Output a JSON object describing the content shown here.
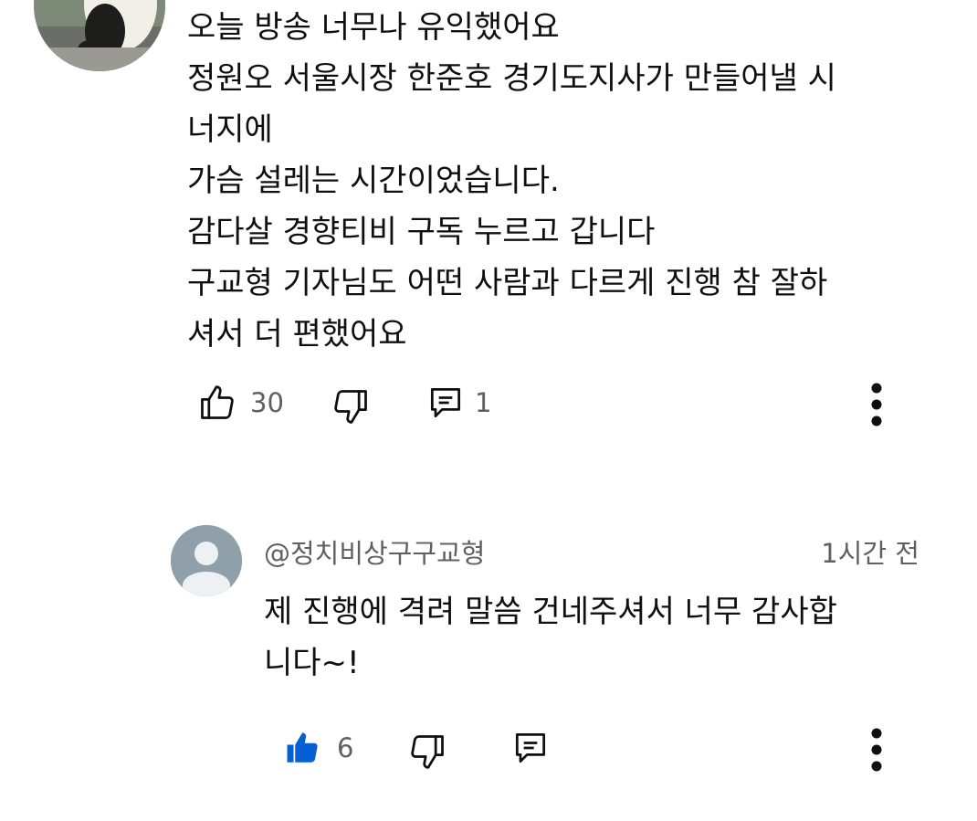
{
  "comment": {
    "lines": [
      "오늘 방송 너무나 유익했어요",
      "정원오 서울시장 한준호 경기도지사가 만들어낼 시",
      "너지에",
      "가슴 설레는 시간이었습니다.",
      "감다살 경향티비 구독 누르고 갑니다",
      "구교형 기자님도 어떤 사람과 다르게 진행 참 잘하",
      "셔서 더 편했어요"
    ],
    "like_count": "30",
    "reply_count": "1",
    "liked": false,
    "icons": [
      "thumbs-up-icon",
      "thumbs-down-icon",
      "reply-comment-icon",
      "more-vertical-icon"
    ]
  },
  "reply": {
    "handle": "@정치비상구구교형",
    "time": "1시간 전",
    "lines": [
      "제 진행에 격려 말씀 건네주셔서 너무 감사합",
      "니다~!"
    ],
    "like_count": "6",
    "liked": true,
    "icons": [
      "thumbs-up-filled-icon",
      "thumbs-down-icon",
      "reply-comment-icon",
      "more-vertical-icon"
    ]
  },
  "colors": {
    "text": "#0f0f0f",
    "secondary": "#606060",
    "liked_blue": "#065fd4",
    "default_avatar_bg": "#8fa0ab"
  }
}
